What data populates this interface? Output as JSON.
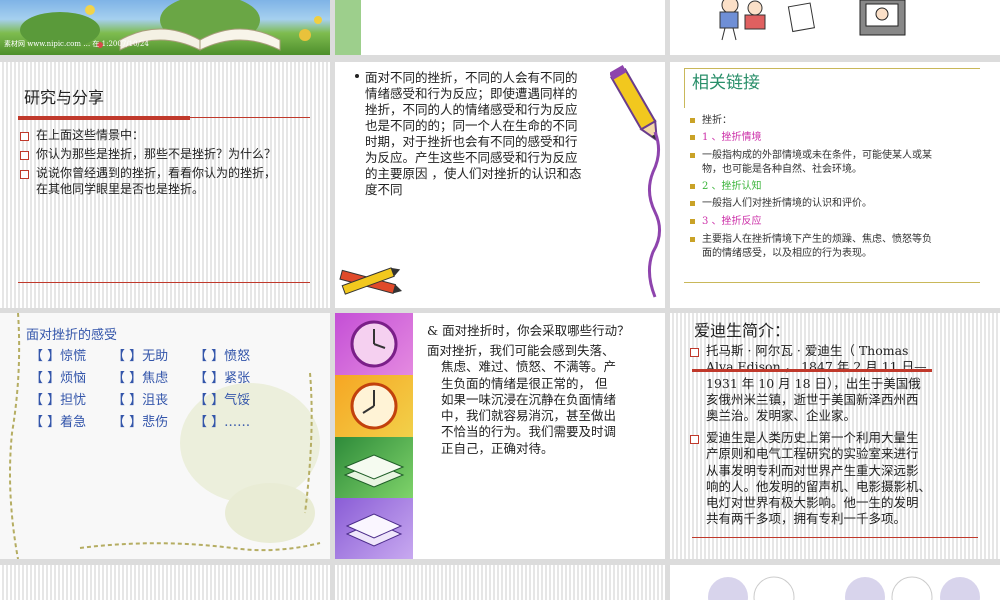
{
  "slide1": {
    "watermark": "素材网 www.nipic.com … 在 1:2007/10/24"
  },
  "slide4": {
    "title": "研究与分享",
    "bullets": [
      "在上面这些情景中：",
      "你认为那些是挫折，那些不是挫折？为什么？",
      "说说你曾经遇到的挫折，看看你认为的挫折，",
      "在其他同学眼里是否也是挫折。"
    ]
  },
  "slide5": {
    "lines": [
      "面对不同的挫折，不同的人会有不同的",
      "情绪感受和行为反应；即使遭遇同样的",
      "挫折，不同的人的情绪感受和行为反应",
      "也是不同的的；同一个人在生命的不同",
      "时期，对于挫折也会有不同的感受和行",
      "为反应。产生这些不同感受和行为反应",
      "的主要原因 ，使人们对挫折的认识和态",
      "度不同"
    ]
  },
  "slide6": {
    "title": "相关链接",
    "items": [
      {
        "text": "挫折：",
        "color": "#333333"
      },
      {
        "text": "1 、挫折情境",
        "color": "#cc2fa8"
      },
      {
        "text": "一般指构成的外部情境或未在条件，可能使某人或某",
        "color": "#333333"
      },
      {
        "text": "物，也可能是各种自然、社会环境。",
        "color": "#333333",
        "indent": true
      },
      {
        "text": "2 、挫折认知",
        "color": "#3cb43c"
      },
      {
        "text": "一般指人们对挫折情境的认识和评价。",
        "color": "#333333"
      },
      {
        "text": "3 、挫折反应",
        "color": "#cc2fa8"
      },
      {
        "text": "主要指人在挫折情境下产生的烦躁、焦虑、愤怒等负",
        "color": "#333333"
      },
      {
        "text": "面的情绪感受，以及相应的行为表现。",
        "color": "#333333",
        "indent": true
      }
    ]
  },
  "slide7": {
    "title": "面对挫折的感受",
    "rows": [
      [
        "【 】惊慌",
        "【 】无助",
        "【 】愤怒"
      ],
      [
        "【 】烦恼",
        "【 】焦虑",
        "【 】紧张"
      ],
      [
        "【 】担忧",
        "【 】沮丧",
        "【 】气馁"
      ],
      [
        "【 】着急",
        "【 】悲伤",
        "【 】……"
      ]
    ]
  },
  "slide8": {
    "question": "&  面对挫折时，你会采取哪些行动？",
    "lines": [
      "面对挫折，我们可能会感到失落、",
      "焦虑、难过、愤怒、不满等。产",
      "生负面的情绪是很正常的， 但",
      "如果一味沉浸在沉静在负面情绪",
      "中，我们就容易消沉，甚至做出",
      "不恰当的行为。我们需要及时调",
      "正自己，正确对待。"
    ]
  },
  "slide9": {
    "title": "爱迪生简介：",
    "p1": [
      "托马斯 · 阿尔瓦 · 爱迪生（ Thomas",
      "Alva Edison ， 1847 年 2 月 11 日—",
      "1931 年 10 月 18 日），出生于美国俄",
      "亥俄州米兰镇，逝世于美国新泽西州西",
      "奥兰治。发明家、企业家。"
    ],
    "p2": [
      "爱迪生是人类历史上第一个利用大量生",
      "产原则和电气工程研究的实验室来进行",
      "从事发明专利而对世界产生重大深远影",
      "响的人。他发明的留声机、电影摄影机、",
      "电灯对世界有极大影响。他一生的发明",
      "共有两千多项，拥有专利一千多项。"
    ]
  },
  "colors": {
    "accent_red": "#c0392b",
    "gold": "#c9a227",
    "blue_text": "#3355aa",
    "teal_title": "#2a8f6a"
  }
}
